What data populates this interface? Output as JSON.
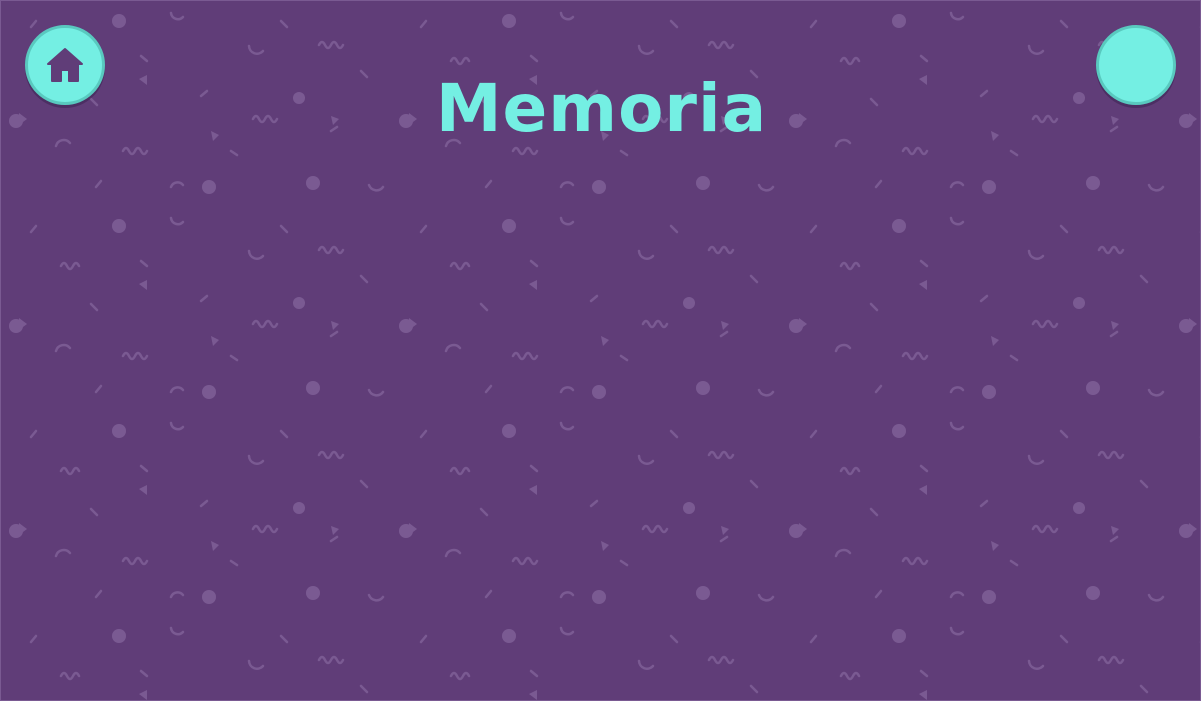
{
  "app": {
    "title": "Memoria"
  },
  "controls": {
    "home_button_icon": "home-icon",
    "right_button_icon": "none"
  },
  "colors": {
    "background": "#603d78",
    "accent": "#74efe3",
    "pattern": "#7a5a92"
  }
}
